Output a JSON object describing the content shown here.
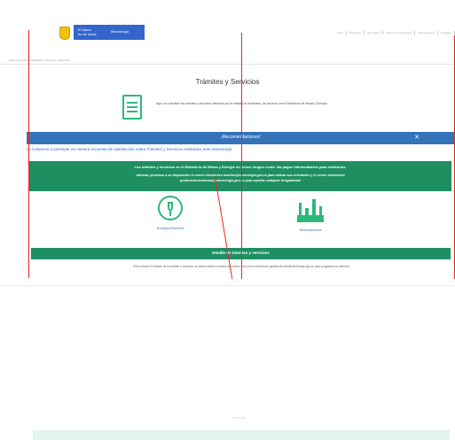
{
  "header": {
    "gov_line1": "El futuro",
    "gov_line2": "es de todos",
    "gov_partner": "Minenergía",
    "top_links": [
      "Inicio",
      "Ministerio",
      "Normativa",
      "Atención al ciudadano",
      "Transparencia",
      "Participa"
    ]
  },
  "breadcrumb": "Inicio / Atención al ciudadano / Trámites y Servicios",
  "page": {
    "title": "Trámites y Servicios",
    "intro": "Aquí se consultan los trámites y servicios ofrecidos por la entidad al ciudadano, de acuerdo con el Ministerio de Minas y Energía."
  },
  "announcement": {
    "label": "¡Recomendaciones!",
    "close": "✕",
    "invite": "Lo invitamos a participar en nuestra encuesta de satisfacción sobre Trámites y Servicios realizados ante Minenergía",
    "notice_line1": "Los trámites y servicios en el Ministerio de Minas y Energía no tienen ningún costo. No pague intermediarios para realizarlos.",
    "notice_line2": "Además, ponemos a su disposición el correo electrónico tramites@minenergia.gov.co para radicar sus solicitudes y el correo electrónico",
    "notice_line3": "gestioncheckenlineas@minenergia.gov.co para reportar cualquier irregularidad"
  },
  "categories": [
    {
      "label": "Energía Eléctrica"
    },
    {
      "label": "Hidrocarburos"
    }
  ],
  "detail": {
    "bar_label": "Detalle de trámites y servicios",
    "footnote": "Para conocer el estado de su trámite o consulta, se podrá realizar a través del mismo o al correo electrónico gestionclientes@minenergia.gov.co para programar su atención."
  },
  "bottom": {
    "ghost_text": "Minenergía"
  }
}
